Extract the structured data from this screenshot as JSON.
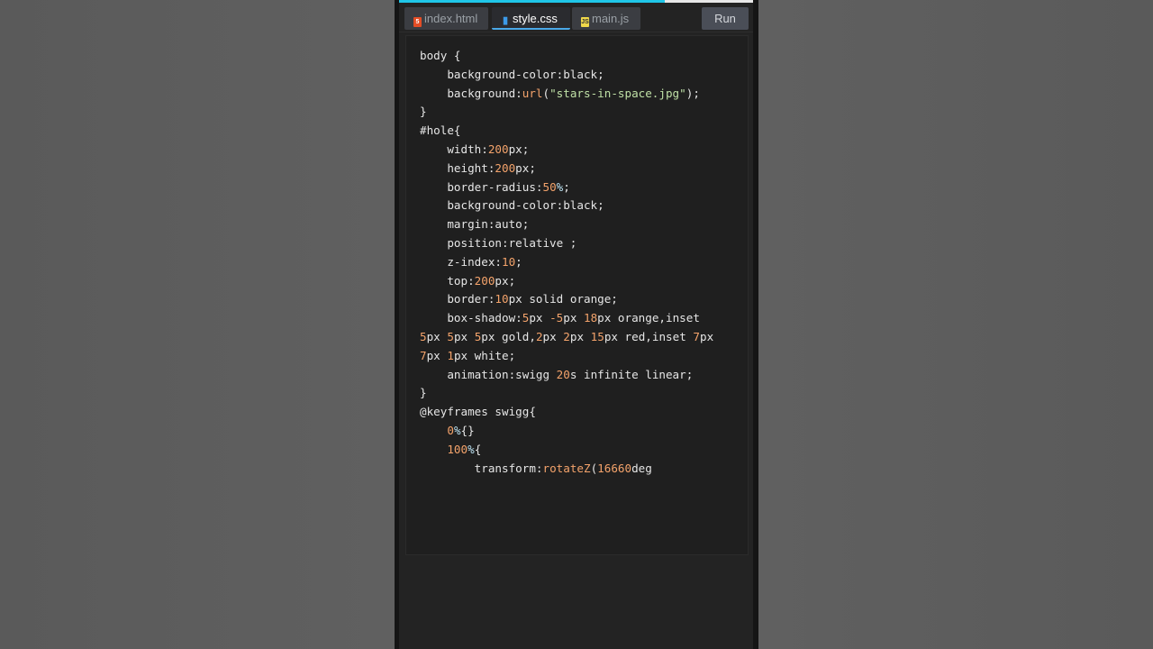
{
  "tabs": [
    {
      "label": "index.html",
      "icon": "html5-icon",
      "active": false
    },
    {
      "label": "style.css",
      "icon": "css3-icon",
      "active": true
    },
    {
      "label": "main.js",
      "icon": "js-icon",
      "active": false
    }
  ],
  "run_label": "Run",
  "colors": {
    "progress": "#1fc6e8",
    "number": "#f4a36b",
    "string": "#bfe0a6",
    "text": "#e6e6e6",
    "editor_bg": "#1f1f1f"
  },
  "code_lines": [
    [
      [
        "body {",
        "t"
      ]
    ],
    [
      [
        "    background-color:black;",
        "t"
      ]
    ],
    [
      [
        "    background:",
        "t"
      ],
      [
        "url",
        "fn"
      ],
      [
        "(",
        "t"
      ],
      [
        "\"stars-in-space.jpg\"",
        "str"
      ],
      [
        ");",
        "t"
      ]
    ],
    [
      [
        "}",
        "t"
      ]
    ],
    [
      [
        "#hole{",
        "t"
      ]
    ],
    [
      [
        "    width:",
        "t"
      ],
      [
        "200",
        "num"
      ],
      [
        "px;",
        "t"
      ]
    ],
    [
      [
        "    height:",
        "t"
      ],
      [
        "200",
        "num"
      ],
      [
        "px;",
        "t"
      ]
    ],
    [
      [
        "    border-radius:",
        "t"
      ],
      [
        "50",
        "num"
      ],
      [
        "%",
        "pct"
      ],
      [
        ";",
        "t"
      ]
    ],
    [
      [
        "    background-color:black;",
        "t"
      ]
    ],
    [
      [
        "    margin:auto;",
        "t"
      ]
    ],
    [
      [
        "    position:relative ;",
        "t"
      ]
    ],
    [
      [
        "    z-index:",
        "t"
      ],
      [
        "10",
        "num"
      ],
      [
        ";",
        "t"
      ]
    ],
    [
      [
        "    top:",
        "t"
      ],
      [
        "200",
        "num"
      ],
      [
        "px;",
        "t"
      ]
    ],
    [
      [
        "    border:",
        "t"
      ],
      [
        "10",
        "num"
      ],
      [
        "px solid orange;",
        "t"
      ]
    ],
    [
      [
        "    box-shadow:",
        "t"
      ],
      [
        "5",
        "num"
      ],
      [
        "px ",
        "t"
      ],
      [
        "-5",
        "num"
      ],
      [
        "px ",
        "t"
      ],
      [
        "18",
        "num"
      ],
      [
        "px orange,inset",
        "t"
      ]
    ],
    [
      [
        "5",
        "num"
      ],
      [
        "px ",
        "t"
      ],
      [
        "5",
        "num"
      ],
      [
        "px ",
        "t"
      ],
      [
        "5",
        "num"
      ],
      [
        "px gold,",
        "t"
      ],
      [
        "2",
        "num"
      ],
      [
        "px ",
        "t"
      ],
      [
        "2",
        "num"
      ],
      [
        "px ",
        "t"
      ],
      [
        "15",
        "num"
      ],
      [
        "px red,inset ",
        "t"
      ],
      [
        "7",
        "num"
      ],
      [
        "px",
        "t"
      ]
    ],
    [
      [
        "7",
        "num"
      ],
      [
        "px ",
        "t"
      ],
      [
        "1",
        "num"
      ],
      [
        "px white;",
        "t"
      ]
    ],
    [
      [
        "    animation:swigg ",
        "t"
      ],
      [
        "20",
        "num"
      ],
      [
        "s infinite linear;",
        "t"
      ]
    ],
    [
      [
        "}",
        "t"
      ]
    ],
    [
      [
        "@keyframes swigg{",
        "t"
      ]
    ],
    [
      [
        "    ",
        "t"
      ],
      [
        "0",
        "num"
      ],
      [
        "%",
        "pct"
      ],
      [
        "{}",
        "t"
      ]
    ],
    [
      [
        "    ",
        "t"
      ],
      [
        "100",
        "num"
      ],
      [
        "%",
        "pct"
      ],
      [
        "{",
        "t"
      ]
    ],
    [
      [
        "        transform:",
        "t"
      ],
      [
        "rotateZ",
        "fn"
      ],
      [
        "(",
        "t"
      ],
      [
        "16660",
        "num"
      ],
      [
        "deg",
        "t"
      ]
    ]
  ]
}
